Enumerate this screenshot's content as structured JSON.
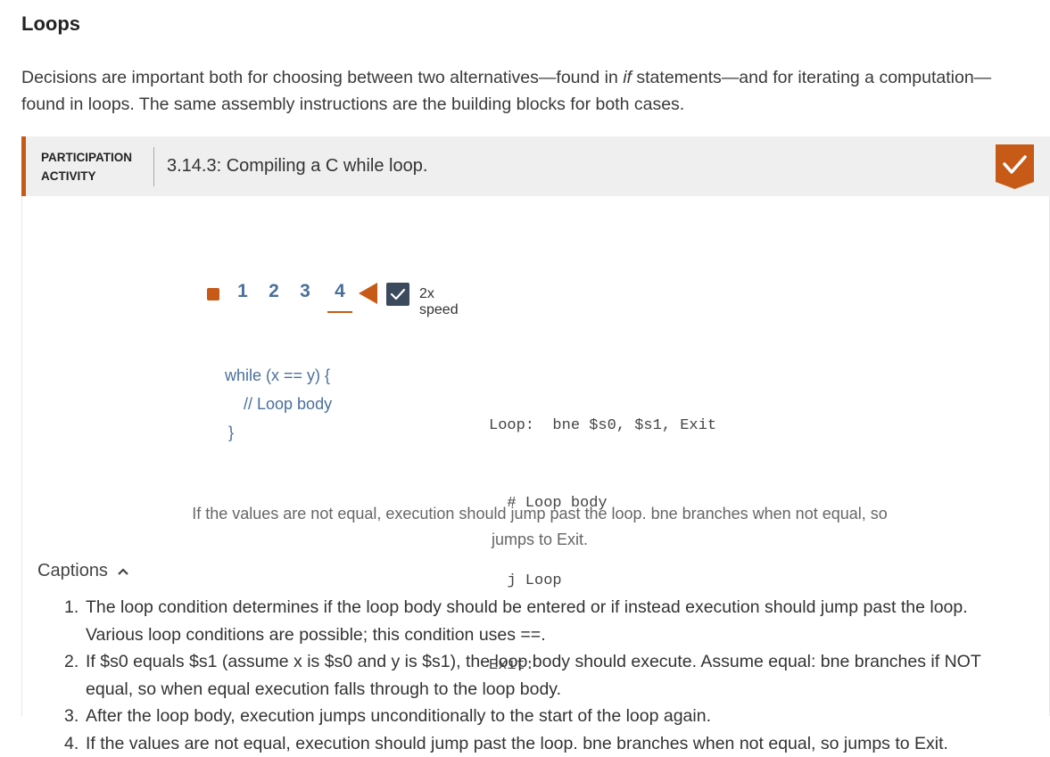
{
  "section": {
    "title": "Loops",
    "intro_part1": "Decisions are important both for choosing between two alternatives—found in ",
    "intro_em": "if",
    "intro_part2": " statements—and for iterating a computation—found in loops. The same assembly instructions are the building blocks for both cases."
  },
  "activity": {
    "type_line1": "PARTICIPATION",
    "type_line2": "ACTIVITY",
    "title": "3.14.3: Compiling a C while loop.",
    "complete_icon": "check-badge-icon",
    "accent_color": "#c65a16",
    "controls": {
      "steps": [
        "1",
        "2",
        "3",
        "4"
      ],
      "current_step": "4",
      "speed_label": "2x speed",
      "speed_checked": true
    },
    "c_code": {
      "line1": "while (x == y) {",
      "line2": "// Loop body",
      "line3": "}"
    },
    "asm_code": {
      "line1": "Loop:  bne $s0, $s1, Exit",
      "line2": "  # Loop body",
      "line3": "  j Loop",
      "line4": "Exit:"
    },
    "current_caption": "If the values are not equal, execution should jump past the loop. bne branches when not equal, so jumps to Exit.",
    "captions_label": "Captions",
    "captions": [
      {
        "num": "1.",
        "text": "The loop condition determines if the loop body should be entered or if instead execution should jump past the loop. Various loop conditions are possible; this condition uses ==."
      },
      {
        "num": "2.",
        "text": "If $s0 equals $s1 (assume x is $s0 and y is $s1), the loop body should execute. Assume equal: bne branches if NOT equal, so when equal execution falls through to the loop body."
      },
      {
        "num": "3.",
        "text": "After the loop body, execution jumps unconditionally to the start of the loop again."
      },
      {
        "num": "4.",
        "text": "If the values are not equal, execution should jump past the loop. bne branches when not equal, so jumps to Exit."
      }
    ]
  }
}
